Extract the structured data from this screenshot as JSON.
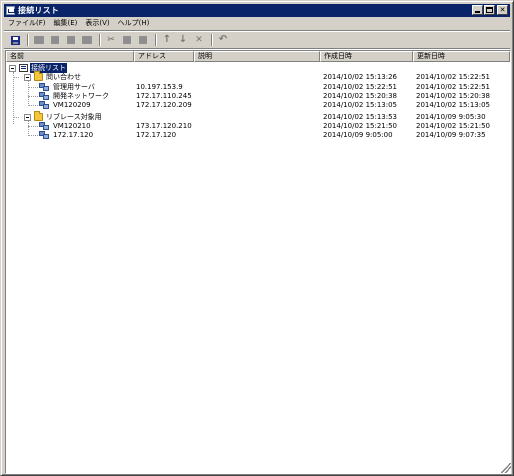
{
  "window": {
    "title": "接続リスト",
    "title_bar_color": "#0a246a",
    "buttons": {
      "minimize_icon": "minimize-icon",
      "maximize_icon": "maximize-icon",
      "close_label": "✕"
    }
  },
  "menu": {
    "items": [
      {
        "label": "ファイル(F)"
      },
      {
        "label": "編集(E)"
      },
      {
        "label": "表示(V)"
      },
      {
        "label": "ヘルプ(H)"
      }
    ]
  },
  "toolbar": {
    "icons": [
      "save-icon",
      "connect-icon",
      "search-icon",
      "copy-icon",
      "properties-icon",
      "cut-icon",
      "copy-item-icon",
      "paste-icon",
      "up-arrow-icon",
      "down-arrow-icon",
      "delete-icon",
      "undo-icon"
    ],
    "cut_glyph": "✂",
    "up_glyph": "↑",
    "down_glyph": "↓",
    "delete_glyph": "✕",
    "undo_glyph": "↶"
  },
  "list": {
    "columns": [
      "名前",
      "アドレス",
      "説明",
      "作成日時",
      "更新日時"
    ],
    "root": {
      "label": "接続リスト"
    },
    "rows": [
      {
        "name": "問い合わせ",
        "address": "",
        "description": "",
        "created": "2014/10/02 15:13:26",
        "updated": "2014/10/02 15:22:51"
      },
      {
        "name": "管理用サーバ",
        "address": "10.197.153.9",
        "description": "",
        "created": "2014/10/02 15:22:51",
        "updated": "2014/10/02 15:22:51"
      },
      {
        "name": "開発ネットワーク",
        "address": "172.17.110.245",
        "description": "",
        "created": "2014/10/02 15:20:38",
        "updated": "2014/10/02 15:20:38"
      },
      {
        "name": "VM120209",
        "address": "172.17.120.209",
        "description": "",
        "created": "2014/10/02 15:13:05",
        "updated": "2014/10/02 15:13:05"
      },
      {
        "name": "リブレース対象用",
        "address": "",
        "description": "",
        "created": "2014/10/02 15:13:53",
        "updated": "2014/10/09 9:05:30"
      },
      {
        "name": "VM120210",
        "address": "173.17.120.210",
        "description": "",
        "created": "2014/10/02 15:21:50",
        "updated": "2014/10/02 15:21:50"
      },
      {
        "name": "172.17.120",
        "address": "172.17.120",
        "description": "",
        "created": "2014/10/09 9:05:00",
        "updated": "2014/10/09 9:07:35"
      }
    ]
  }
}
